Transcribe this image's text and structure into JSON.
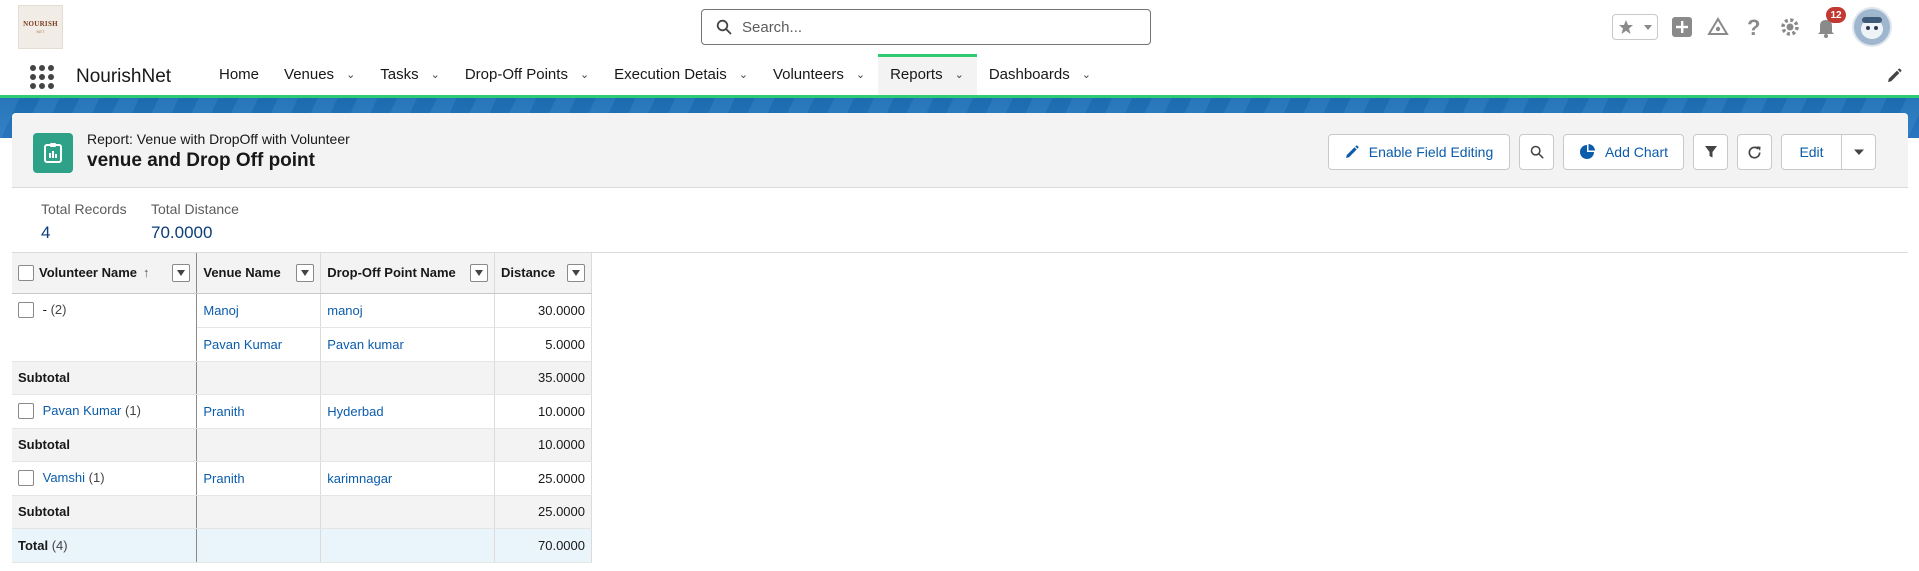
{
  "header": {
    "logo_text": "NOURISH",
    "logo_sub": "NET",
    "search_placeholder": "Search...",
    "notifications_count": "12"
  },
  "nav": {
    "app_name": "NourishNet",
    "items": [
      {
        "label": "Home",
        "has_menu": false
      },
      {
        "label": "Venues",
        "has_menu": true
      },
      {
        "label": "Tasks",
        "has_menu": true
      },
      {
        "label": "Drop-Off Points",
        "has_menu": true
      },
      {
        "label": "Execution Detais",
        "has_menu": true
      },
      {
        "label": "Volunteers",
        "has_menu": true
      },
      {
        "label": "Reports",
        "has_menu": true,
        "active": true
      },
      {
        "label": "Dashboards",
        "has_menu": true
      }
    ]
  },
  "report": {
    "eyebrow": "Report: Venue with DropOff with Volunteer",
    "title": "venue and Drop Off point",
    "actions": {
      "enable_field_editing": "Enable Field Editing",
      "add_chart": "Add Chart",
      "edit": "Edit"
    }
  },
  "summary": {
    "total_records_label": "Total Records",
    "total_records_value": "4",
    "total_distance_label": "Total Distance",
    "total_distance_value": "70.0000"
  },
  "table": {
    "columns": {
      "volunteer": "Volunteer Name",
      "venue": "Venue Name",
      "dropoff": "Drop-Off Point Name",
      "distance": "Distance"
    },
    "groups": [
      {
        "volunteer": "-",
        "count": "(2)",
        "rows": [
          {
            "venue": "Manoj",
            "dropoff": "manoj",
            "distance": "30.0000"
          },
          {
            "venue": "Pavan Kumar",
            "dropoff": "Pavan kumar",
            "distance": "5.0000"
          }
        ],
        "subtotal_label": "Subtotal",
        "subtotal": "35.0000"
      },
      {
        "volunteer": "Pavan Kumar",
        "count": "(1)",
        "rows": [
          {
            "venue": "Pranith",
            "dropoff": "Hyderbad",
            "distance": "10.0000"
          }
        ],
        "subtotal_label": "Subtotal",
        "subtotal": "10.0000"
      },
      {
        "volunteer": "Vamshi",
        "count": "(1)",
        "rows": [
          {
            "venue": "Pranith",
            "dropoff": "karimnagar",
            "distance": "25.0000"
          }
        ],
        "subtotal_label": "Subtotal",
        "subtotal": "25.0000"
      }
    ],
    "total_label": "Total",
    "total_count": "(4)",
    "total_value": "70.0000"
  }
}
